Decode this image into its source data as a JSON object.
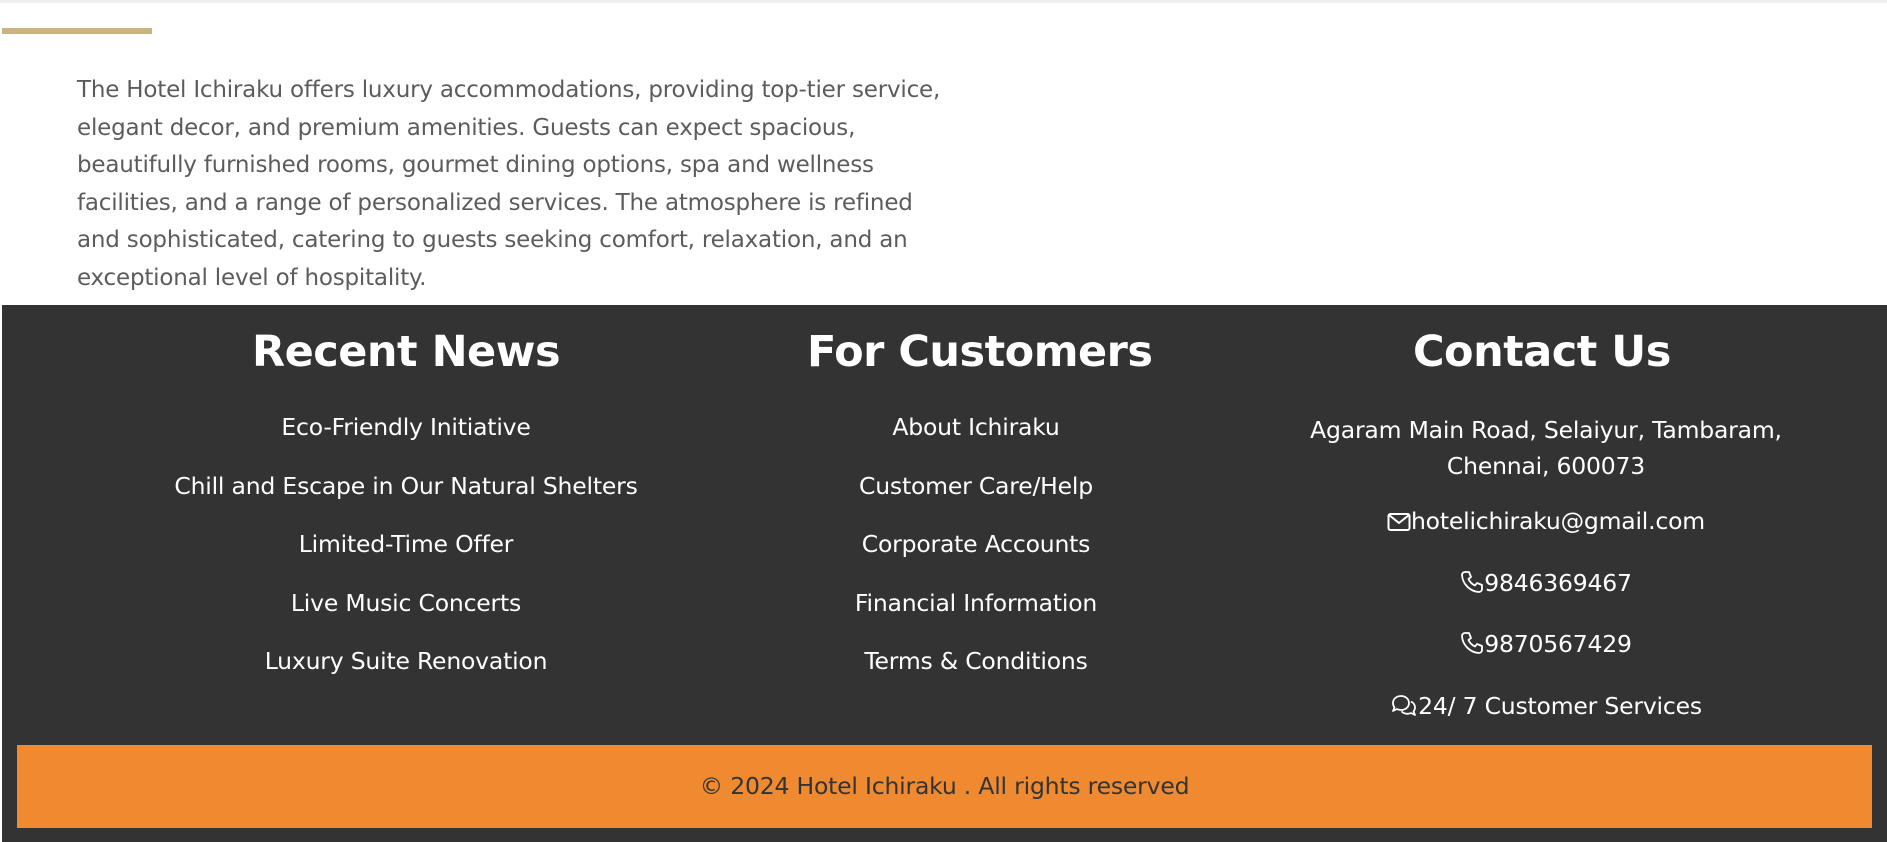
{
  "about": {
    "text": "The Hotel Ichiraku offers luxury accommodations, providing top-tier service, elegant decor, and premium amenities. Guests can expect spacious, beautifully furnished rooms, gourmet dining options, spa and wellness facilities, and a range of personalized services. The atmosphere is refined and sophisticated, catering to guests seeking comfort, relaxation, and an exceptional level of hospitality."
  },
  "footer": {
    "recent_news": {
      "heading": "Recent News",
      "items": [
        "Eco-Friendly Initiative",
        "Chill and Escape in Our Natural Shelters",
        "Limited-Time Offer",
        "Live Music Concerts",
        "Luxury Suite Renovation"
      ]
    },
    "for_customers": {
      "heading": "For Customers",
      "items": [
        "About Ichiraku",
        "Customer Care/Help",
        "Corporate Accounts",
        "Financial Information",
        "Terms & Conditions"
      ]
    },
    "contact": {
      "heading": "Contact Us",
      "address": "Agaram Main Road, Selaiyur, Tambaram, Chennai, 600073",
      "email": "hotelichiraku@gmail.com",
      "phone1": "9846369467",
      "phone2": "9870567429",
      "service": "24/ 7 Customer Services"
    },
    "copyright": "© 2024 Hotel Ichiraku . All rights reserved"
  },
  "colors": {
    "footer_bg": "#333333",
    "copyright_bg": "#f08a30",
    "accent_line": "#c9b380",
    "body_text": "#5c5c5c"
  },
  "icons": {
    "email": "envelope-icon",
    "phone": "phone-icon",
    "service": "chat-icon"
  }
}
